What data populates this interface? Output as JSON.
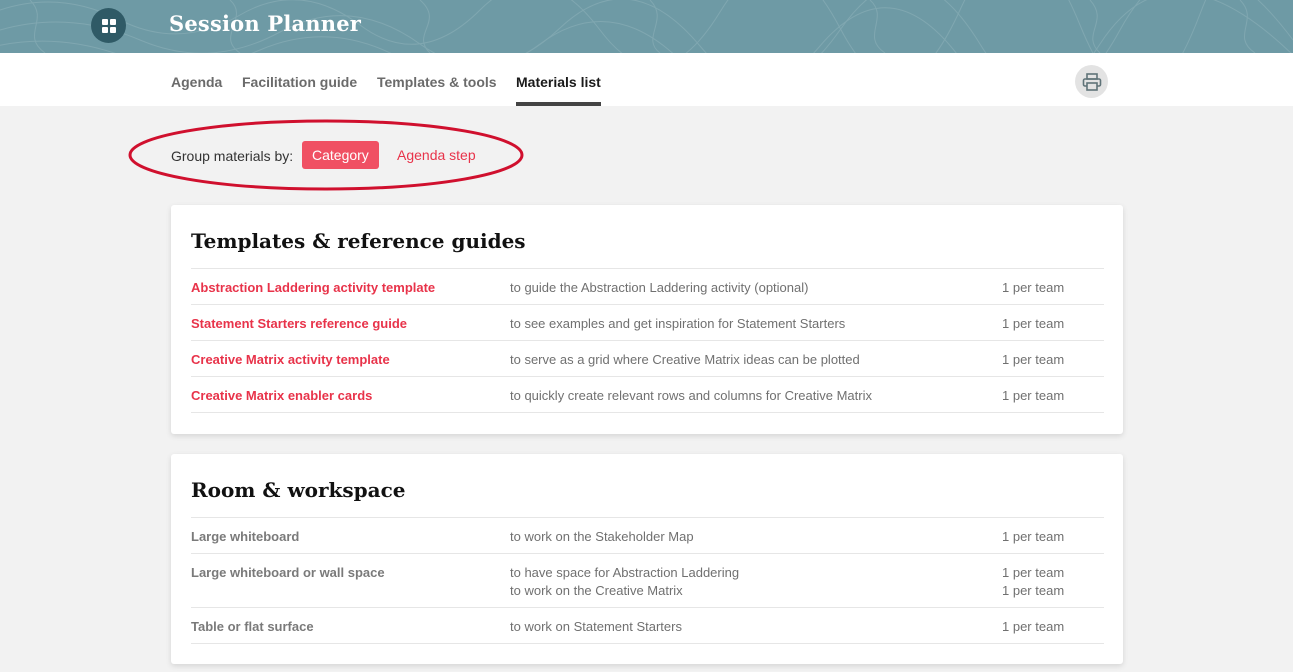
{
  "app": {
    "title": "Session Planner",
    "icon": "grid-icon"
  },
  "tabs": [
    {
      "label": "Agenda",
      "active": false
    },
    {
      "label": "Facilitation guide",
      "active": false
    },
    {
      "label": "Templates & tools",
      "active": false
    },
    {
      "label": "Materials list",
      "active": true
    }
  ],
  "print": {
    "icon": "printer-icon"
  },
  "grouping": {
    "label": "Group materials by:",
    "options": [
      {
        "label": "Category",
        "selected": true
      },
      {
        "label": "Agenda step",
        "selected": false
      }
    ],
    "highlight_color": "#d0102e"
  },
  "sections": [
    {
      "title": "Templates & reference guides",
      "items": [
        {
          "name": "Abstraction Laddering activity template",
          "purposes": [
            "to guide the Abstraction Laddering activity (optional)"
          ],
          "quantities": [
            "1 per team"
          ],
          "link": true
        },
        {
          "name": "Statement Starters reference guide",
          "purposes": [
            "to see examples and get inspiration for Statement Starters"
          ],
          "quantities": [
            "1 per team"
          ],
          "link": true
        },
        {
          "name": "Creative Matrix activity template",
          "purposes": [
            "to serve as a grid where Creative Matrix ideas can be plotted"
          ],
          "quantities": [
            "1 per team"
          ],
          "link": true
        },
        {
          "name": "Creative Matrix enabler cards",
          "purposes": [
            "to quickly create relevant rows and columns for Creative Matrix"
          ],
          "quantities": [
            "1 per team"
          ],
          "link": true
        }
      ]
    },
    {
      "title": "Room & workspace",
      "items": [
        {
          "name": "Large whiteboard",
          "purposes": [
            "to work on the Stakeholder Map"
          ],
          "quantities": [
            "1 per team"
          ],
          "link": false
        },
        {
          "name": "Large whiteboard or wall space",
          "purposes": [
            "to have space for Abstraction Laddering",
            "to work on the Creative Matrix"
          ],
          "quantities": [
            "1 per team",
            "1 per team"
          ],
          "link": false
        },
        {
          "name": "Table or flat surface",
          "purposes": [
            "to work on Statement Starters"
          ],
          "quantities": [
            "1 per team"
          ],
          "link": false
        }
      ]
    }
  ],
  "colors": {
    "banner": "#6e9aa5",
    "accent": "#f05063",
    "link": "#e8334a"
  }
}
